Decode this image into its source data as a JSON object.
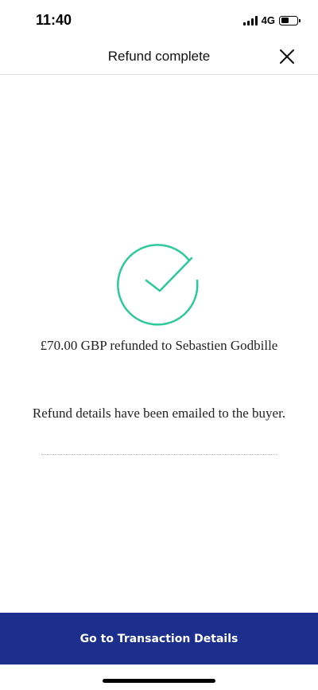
{
  "status_bar": {
    "time": "11:40",
    "network": "4G",
    "icons": [
      "signal-icon",
      "battery-icon"
    ]
  },
  "header": {
    "title": "Refund complete",
    "close_icon": "close-icon"
  },
  "main": {
    "success_icon": "check-circle-icon",
    "refund_message": "£70.00 GBP refunded to Sebastien Godbille",
    "email_message": "Refund details have been emailed to the buyer."
  },
  "footer": {
    "button_label": "Go to Transaction Details"
  },
  "colors": {
    "accent_green": "#2ec99a",
    "button_blue": "#1c2f8d"
  }
}
